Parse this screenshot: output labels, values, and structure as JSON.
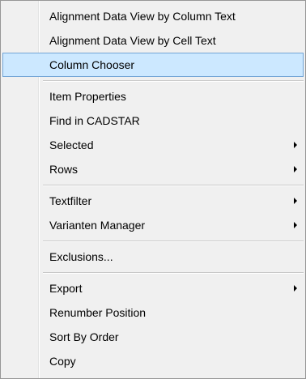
{
  "context_menu": {
    "items": [
      {
        "label": "Alignment Data View by Column Text"
      },
      {
        "label": "Alignment Data View by Cell Text"
      },
      {
        "label": "Column Chooser",
        "highlighted": true
      },
      {
        "label": "Item Properties"
      },
      {
        "label": "Find in CADSTAR"
      },
      {
        "label": "Selected",
        "submenu": true
      },
      {
        "label": "Rows",
        "submenu": true
      },
      {
        "label": "Textfilter",
        "submenu": true
      },
      {
        "label": "Varianten Manager",
        "submenu": true
      },
      {
        "label": "Exclusions..."
      },
      {
        "label": "Export",
        "submenu": true
      },
      {
        "label": "Renumber Position"
      },
      {
        "label": "Sort By Order"
      },
      {
        "label": "Copy"
      }
    ],
    "colors": {
      "background": "#f0f0f0",
      "highlight": "#cce8ff",
      "highlight_border": "#73a5d6"
    }
  }
}
